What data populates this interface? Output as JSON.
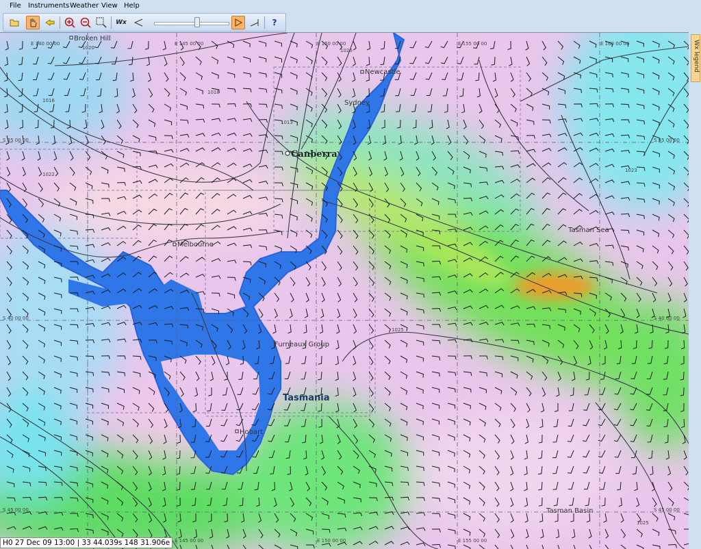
{
  "menu": [
    "File",
    "Instruments",
    "Weather",
    "View",
    "Help"
  ],
  "toolbar": {
    "buttons": [
      "folder-open-icon",
      "hand-pan-icon",
      "pointer-icon",
      "zoom-in-icon",
      "zoom-out-icon",
      "zoom-rect-icon",
      "wind-icon",
      "step-back-icon",
      "play-icon",
      "step-forward-icon",
      "help-icon"
    ],
    "wind_label": "Wx",
    "help_label": "?"
  },
  "legend_tab": "Wx legend",
  "status": {
    "text": "H0 27 Dec 09 13:00 | 33 44.039s  148 31.906e"
  },
  "map": {
    "places": [
      {
        "name": "Broken Hill"
      },
      {
        "name": "Newcastle"
      },
      {
        "name": "Sydney"
      },
      {
        "name": "Canberra"
      },
      {
        "name": "Melbourne"
      },
      {
        "name": "Hobart"
      }
    ],
    "regions": [
      "Tasman Sea",
      "Furneaux Group",
      "Tasmania",
      "Tasman Basin"
    ],
    "lon_labels": [
      "E 140 00 00",
      "E 145 00 00",
      "E 150 00 00",
      "E 155 00 00",
      "E 160 00 00"
    ],
    "lat_labels": [
      "S 35 00 00",
      "S 40 00 00",
      "S 45 00 00"
    ],
    "isobars": [
      "1020",
      "1016",
      "1018",
      "1013",
      "1023",
      "1022",
      "1025",
      "1026"
    ],
    "colors": {
      "land": "#2f76e8",
      "wind_high": "#ef9b2a",
      "wind_mid": "#6fe05a",
      "calm": "#f2cbe8"
    }
  }
}
